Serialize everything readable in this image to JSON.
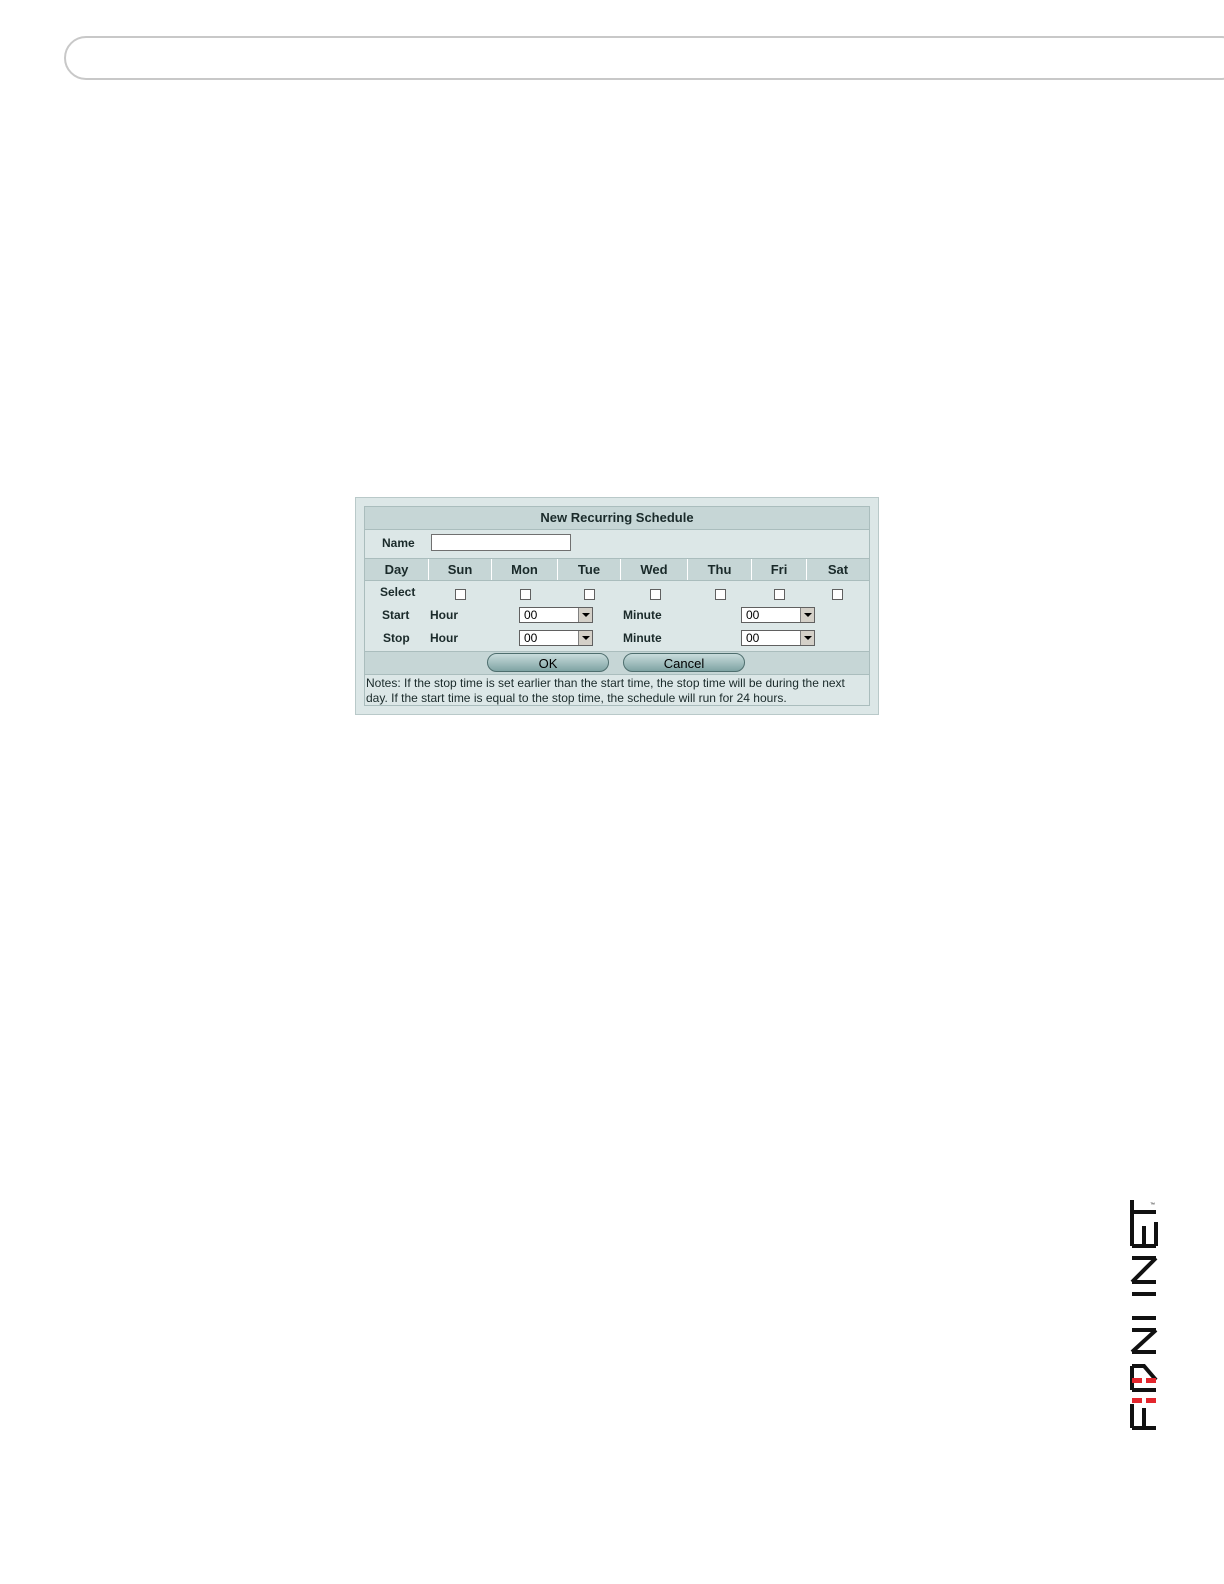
{
  "dialog": {
    "title": "New Recurring Schedule",
    "name_label": "Name",
    "name_value": "",
    "day_label": "Day",
    "days": [
      "Sun",
      "Mon",
      "Tue",
      "Wed",
      "Thu",
      "Fri",
      "Sat"
    ],
    "select_label": "Select",
    "start_label": "Start",
    "stop_label": "Stop",
    "hour_label": "Hour",
    "minute_label": "Minute",
    "start_hour": "00",
    "start_minute": "00",
    "stop_hour": "00",
    "stop_minute": "00",
    "ok_label": "OK",
    "cancel_label": "Cancel",
    "notes": "Notes: If the stop time is set earlier than the start time, the stop time will be during the next day. If the start time is equal to the stop time, the schedule will run for 24 hours."
  },
  "logo": {
    "text": "FORTINET",
    "accent_color": "#e3262d"
  }
}
